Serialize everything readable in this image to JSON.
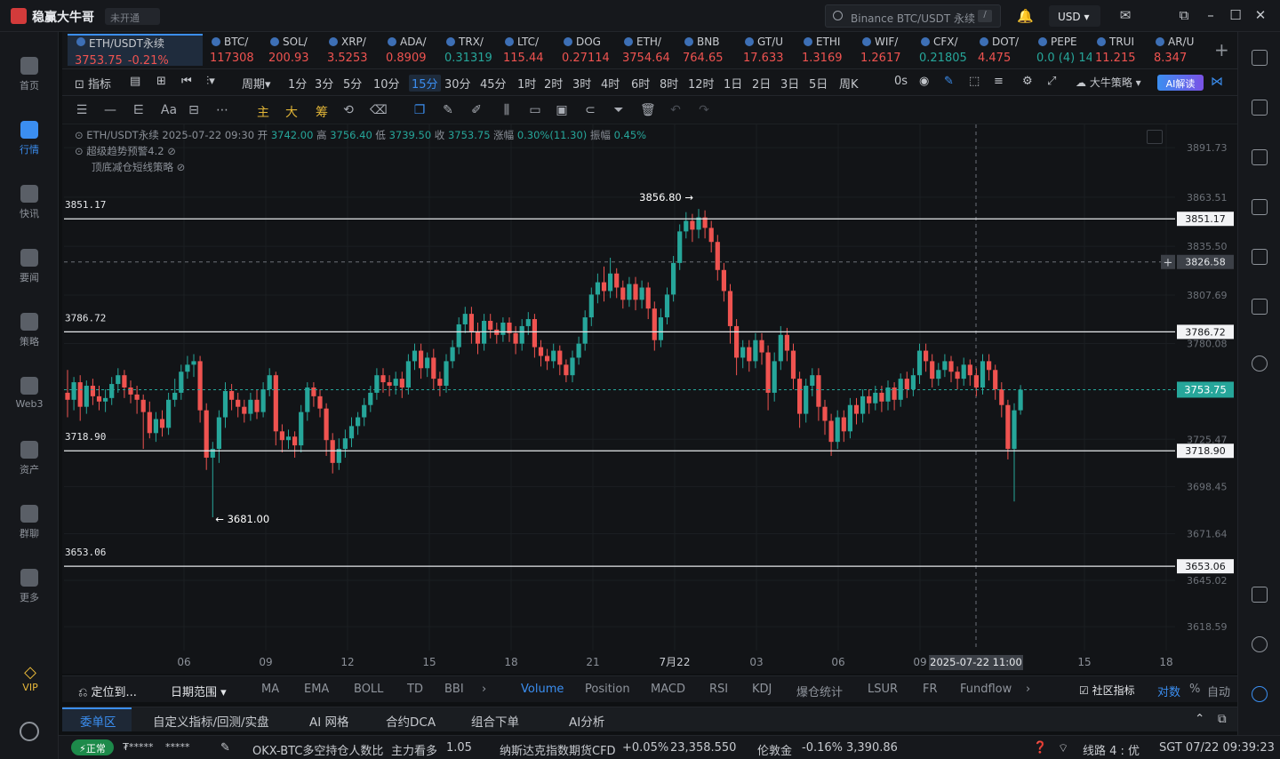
{
  "app": {
    "name": "稳赢大牛哥",
    "account_status": "未开通"
  },
  "search": {
    "placeholder": "Binance BTC/USDT 永续",
    "shortcut": "/"
  },
  "currency": "USD",
  "left_nav": [
    {
      "label": "首页"
    },
    {
      "label": "行情"
    },
    {
      "label": "快讯"
    },
    {
      "label": "要闻"
    },
    {
      "label": "策略"
    },
    {
      "label": "Web3"
    },
    {
      "label": "资产"
    },
    {
      "label": "群聊"
    },
    {
      "label": "更多"
    }
  ],
  "vip_label": "VIP",
  "tickers": [
    {
      "name": "ETH/USDT永续",
      "price": "3753.75",
      "change": "-0.21%",
      "dir": "dn"
    },
    {
      "name": "BTC/",
      "price": "117308",
      "dir": "dn"
    },
    {
      "name": "SOL/",
      "price": "200.93",
      "dir": "dn"
    },
    {
      "name": "XRP/",
      "price": "3.5253",
      "dir": "dn"
    },
    {
      "name": "ADA/",
      "price": "0.8909",
      "dir": "dn"
    },
    {
      "name": "TRX/",
      "price": "0.31319",
      "dir": "up"
    },
    {
      "name": "LTC/",
      "price": "115.44",
      "dir": "dn"
    },
    {
      "name": "DOG",
      "price": "0.27114",
      "dir": "dn"
    },
    {
      "name": "ETH/",
      "price": "3754.64",
      "dir": "dn"
    },
    {
      "name": "BNB",
      "price": "764.65",
      "dir": "dn"
    },
    {
      "name": "GT/U",
      "price": "17.633",
      "dir": "dn"
    },
    {
      "name": "ETHI",
      "price": "1.3169",
      "dir": "dn"
    },
    {
      "name": "WIF/",
      "price": "1.2617",
      "dir": "dn"
    },
    {
      "name": "CFX/",
      "price": "0.21805",
      "dir": "up"
    },
    {
      "name": "DOT/",
      "price": "4.475",
      "dir": "dn"
    },
    {
      "name": "PEPE",
      "price": "0.0 (4) 14",
      "dir": "up"
    },
    {
      "name": "TRUI",
      "price": "11.215",
      "dir": "dn"
    },
    {
      "name": "AR/U",
      "price": "8.347",
      "dir": "dn"
    }
  ],
  "toolbar": {
    "indicator_label": "指标",
    "period_label": "周期",
    "timeframes": [
      "1分",
      "3分",
      "5分",
      "10分",
      "15分",
      "30分",
      "45分",
      "1时",
      "2时",
      "3时",
      "4时",
      "6时",
      "8时",
      "12时",
      "1日",
      "2日",
      "3日",
      "5日",
      "周K"
    ],
    "active_timeframe": "15分",
    "countdown": "0s",
    "strategy_label": "大牛策略",
    "ai_label": "AI解读",
    "main_label": "主",
    "big_label": "大",
    "chip_label": "筹"
  },
  "legend": {
    "symbol": "ETH/USDT永续",
    "time": "2025-07-22 09:30",
    "open_label": "开",
    "open": "3742.00",
    "high_label": "高",
    "high": "3756.40",
    "low_label": "低",
    "low": "3739.50",
    "close_label": "收",
    "close": "3753.75",
    "change_label": "涨幅",
    "change": "0.30%(11.30)",
    "amp_label": "振幅",
    "amp": "0.45%",
    "indicator1": "超级趋势预警4.2",
    "indicator2": "顶底减仓短线策略"
  },
  "chart_data": {
    "type": "candlestick",
    "symbol": "ETH/USDT永续",
    "interval": "15分",
    "price_axis_ticks": [
      3891.73,
      3863.51,
      3835.5,
      3807.69,
      3780.08,
      3725.47,
      3698.45,
      3671.64,
      3645.02,
      3618.59
    ],
    "time_axis_ticks": [
      "06",
      "09",
      "12",
      "15",
      "18",
      "21",
      "7月22",
      "03",
      "06",
      "09",
      "15",
      "18"
    ],
    "crosshair_time": "2025-07-22 11:00",
    "crosshair_price": "3826.58",
    "last_price": "3753.75",
    "horizontal_lines": [
      3851.17,
      3786.72,
      3718.9,
      3653.06
    ],
    "horizontal_line_labels": [
      "3851.17",
      "3786.72",
      "3718.90",
      "3653.06"
    ],
    "annotations": [
      {
        "text": "3856.80 →",
        "price": 3856.8
      },
      {
        "text": "← 3681.00",
        "price": 3681.0
      }
    ],
    "ylim": [
      3605,
      3905
    ],
    "candles": [
      [
        3752,
        3748,
        3738,
        3765
      ],
      [
        3748,
        3758,
        3742,
        3761
      ],
      [
        3758,
        3744,
        3736,
        3762
      ],
      [
        3744,
        3756,
        3740,
        3759
      ],
      [
        3756,
        3750,
        3745,
        3760
      ],
      [
        3750,
        3747,
        3742,
        3756
      ],
      [
        3747,
        3749,
        3741,
        3754
      ],
      [
        3749,
        3757,
        3745,
        3761
      ],
      [
        3757,
        3762,
        3752,
        3766
      ],
      [
        3762,
        3755,
        3749,
        3765
      ],
      [
        3755,
        3751,
        3746,
        3759
      ],
      [
        3751,
        3748,
        3740,
        3756
      ],
      [
        3748,
        3741,
        3720,
        3751
      ],
      [
        3741,
        3729,
        3726,
        3747
      ],
      [
        3729,
        3737,
        3724,
        3741
      ],
      [
        3737,
        3732,
        3727,
        3742
      ],
      [
        3732,
        3748,
        3728,
        3752
      ],
      [
        3748,
        3752,
        3744,
        3760
      ],
      [
        3752,
        3764,
        3748,
        3768
      ],
      [
        3764,
        3768,
        3760,
        3773
      ],
      [
        3768,
        3770,
        3761,
        3774
      ],
      [
        3770,
        3742,
        3735,
        3773
      ],
      [
        3742,
        3715,
        3708,
        3746
      ],
      [
        3715,
        3720,
        3681,
        3724
      ],
      [
        3720,
        3738,
        3712,
        3742
      ],
      [
        3738,
        3753,
        3732,
        3758
      ],
      [
        3753,
        3748,
        3742,
        3757
      ],
      [
        3748,
        3744,
        3738,
        3752
      ],
      [
        3744,
        3740,
        3735,
        3748
      ],
      [
        3740,
        3748,
        3736,
        3752
      ],
      [
        3748,
        3741,
        3737,
        3754
      ],
      [
        3741,
        3754,
        3738,
        3758
      ],
      [
        3754,
        3762,
        3750,
        3766
      ],
      [
        3762,
        3730,
        3722,
        3764
      ],
      [
        3730,
        3725,
        3718,
        3734
      ],
      [
        3725,
        3727,
        3720,
        3731
      ],
      [
        3727,
        3722,
        3715,
        3730
      ],
      [
        3722,
        3741,
        3718,
        3745
      ],
      [
        3741,
        3755,
        3736,
        3758
      ],
      [
        3755,
        3750,
        3744,
        3758
      ],
      [
        3750,
        3743,
        3738,
        3754
      ],
      [
        3743,
        3725,
        3716,
        3746
      ],
      [
        3725,
        3712,
        3706,
        3729
      ],
      [
        3712,
        3720,
        3708,
        3726
      ],
      [
        3720,
        3726,
        3715,
        3731
      ],
      [
        3726,
        3733,
        3721,
        3738
      ],
      [
        3733,
        3738,
        3728,
        3741
      ],
      [
        3738,
        3745,
        3733,
        3749
      ],
      [
        3745,
        3752,
        3741,
        3756
      ],
      [
        3752,
        3762,
        3748,
        3766
      ],
      [
        3762,
        3758,
        3752,
        3766
      ],
      [
        3758,
        3756,
        3750,
        3762
      ],
      [
        3756,
        3760,
        3751,
        3764
      ],
      [
        3760,
        3755,
        3749,
        3764
      ],
      [
        3755,
        3770,
        3751,
        3774
      ],
      [
        3770,
        3776,
        3765,
        3780
      ],
      [
        3776,
        3766,
        3760,
        3780
      ],
      [
        3766,
        3772,
        3761,
        3775
      ],
      [
        3772,
        3760,
        3754,
        3777
      ],
      [
        3760,
        3756,
        3750,
        3764
      ],
      [
        3756,
        3770,
        3752,
        3774
      ],
      [
        3770,
        3778,
        3766,
        3782
      ],
      [
        3778,
        3791,
        3774,
        3795
      ],
      [
        3791,
        3797,
        3786,
        3801
      ],
      [
        3797,
        3787,
        3780,
        3801
      ],
      [
        3787,
        3780,
        3774,
        3792
      ],
      [
        3780,
        3793,
        3776,
        3797
      ],
      [
        3793,
        3788,
        3783,
        3797
      ],
      [
        3788,
        3785,
        3780,
        3792
      ],
      [
        3785,
        3792,
        3781,
        3795
      ],
      [
        3792,
        3786,
        3781,
        3795
      ],
      [
        3786,
        3780,
        3774,
        3790
      ],
      [
        3780,
        3790,
        3776,
        3794
      ],
      [
        3790,
        3794,
        3785,
        3798
      ],
      [
        3794,
        3778,
        3772,
        3797
      ],
      [
        3778,
        3773,
        3767,
        3782
      ],
      [
        3773,
        3770,
        3765,
        3777
      ],
      [
        3770,
        3776,
        3766,
        3780
      ],
      [
        3776,
        3768,
        3762,
        3779
      ],
      [
        3768,
        3762,
        3758,
        3771
      ],
      [
        3762,
        3772,
        3758,
        3776
      ],
      [
        3772,
        3780,
        3768,
        3784
      ],
      [
        3780,
        3795,
        3776,
        3799
      ],
      [
        3795,
        3808,
        3790,
        3812
      ],
      [
        3808,
        3815,
        3803,
        3820
      ],
      [
        3815,
        3810,
        3804,
        3824
      ],
      [
        3810,
        3820,
        3806,
        3829
      ],
      [
        3820,
        3812,
        3806,
        3823
      ],
      [
        3812,
        3805,
        3800,
        3816
      ],
      [
        3805,
        3814,
        3801,
        3818
      ],
      [
        3814,
        3805,
        3799,
        3818
      ],
      [
        3805,
        3812,
        3800,
        3816
      ],
      [
        3812,
        3800,
        3794,
        3815
      ],
      [
        3800,
        3782,
        3776,
        3804
      ],
      [
        3782,
        3795,
        3778,
        3800
      ],
      [
        3795,
        3808,
        3791,
        3812
      ],
      [
        3808,
        3826,
        3804,
        3830
      ],
      [
        3826,
        3844,
        3822,
        3848
      ],
      [
        3844,
        3850,
        3840,
        3855
      ],
      [
        3850,
        3845,
        3838,
        3854
      ],
      [
        3845,
        3852,
        3840,
        3856.8
      ],
      [
        3852,
        3846,
        3840,
        3856
      ],
      [
        3846,
        3838,
        3832,
        3850
      ],
      [
        3838,
        3822,
        3816,
        3842
      ],
      [
        3822,
        3810,
        3804,
        3826
      ],
      [
        3810,
        3790,
        3780,
        3814
      ],
      [
        3790,
        3772,
        3762,
        3794
      ],
      [
        3772,
        3778,
        3766,
        3782
      ],
      [
        3778,
        3770,
        3764,
        3782
      ],
      [
        3770,
        3782,
        3766,
        3786
      ],
      [
        3782,
        3775,
        3768,
        3786
      ],
      [
        3775,
        3752,
        3742,
        3779
      ],
      [
        3752,
        3770,
        3747,
        3775
      ],
      [
        3770,
        3785,
        3765,
        3790
      ],
      [
        3785,
        3776,
        3770,
        3789
      ],
      [
        3776,
        3760,
        3754,
        3780
      ],
      [
        3760,
        3740,
        3732,
        3764
      ],
      [
        3740,
        3756,
        3735,
        3760
      ],
      [
        3756,
        3762,
        3750,
        3766
      ],
      [
        3762,
        3744,
        3736,
        3766
      ],
      [
        3744,
        3736,
        3728,
        3748
      ],
      [
        3736,
        3724,
        3716,
        3740
      ],
      [
        3724,
        3738,
        3720,
        3742
      ],
      [
        3738,
        3730,
        3724,
        3742
      ],
      [
        3730,
        3745,
        3726,
        3749
      ],
      [
        3745,
        3740,
        3734,
        3749
      ],
      [
        3740,
        3750,
        3735,
        3754
      ],
      [
        3750,
        3746,
        3740,
        3754
      ],
      [
        3746,
        3752,
        3742,
        3756
      ],
      [
        3752,
        3747,
        3741,
        3756
      ],
      [
        3747,
        3755,
        3742,
        3759
      ],
      [
        3755,
        3748,
        3742,
        3758
      ],
      [
        3748,
        3760,
        3744,
        3763
      ],
      [
        3760,
        3754,
        3749,
        3764
      ],
      [
        3754,
        3762,
        3750,
        3766
      ],
      [
        3762,
        3776,
        3757,
        3780
      ],
      [
        3776,
        3770,
        3764,
        3780
      ],
      [
        3770,
        3760,
        3755,
        3774
      ],
      [
        3760,
        3765,
        3756,
        3769
      ],
      [
        3765,
        3770,
        3761,
        3774
      ],
      [
        3770,
        3764,
        3758,
        3773
      ],
      [
        3764,
        3760,
        3754,
        3767
      ],
      [
        3760,
        3768,
        3756,
        3772
      ],
      [
        3768,
        3762,
        3756,
        3771
      ],
      [
        3762,
        3755,
        3750,
        3766
      ],
      [
        3755,
        3770,
        3751,
        3774
      ],
      [
        3770,
        3765,
        3759,
        3774
      ],
      [
        3765,
        3754,
        3748,
        3768
      ],
      [
        3754,
        3745,
        3738,
        3758
      ],
      [
        3745,
        3720,
        3714,
        3748
      ],
      [
        3720,
        3742,
        3690,
        3746
      ],
      [
        3742,
        3753.75,
        3739.5,
        3756.4
      ]
    ]
  },
  "indicator_bar": {
    "locate_label": "定位到...",
    "date_range_label": "日期范围",
    "items": [
      "MA",
      "EMA",
      "BOLL",
      "TD",
      "BBI"
    ],
    "sub_items": [
      "Volume",
      "Position",
      "MACD",
      "RSI",
      "KDJ",
      "爆仓统计",
      "LSUR",
      "FR",
      "Fundflow"
    ],
    "active_sub": "Volume",
    "community_label": "社区指标",
    "log_label": "对数",
    "percent_label": "%",
    "auto_label": "自动"
  },
  "order_tabs": [
    "委单区",
    "自定义指标/回测/实盘",
    "AI 网格",
    "合约DCA",
    "组合下单",
    "AI分析"
  ],
  "status_bar": {
    "status": "正常",
    "masked1": "₮*****",
    "masked2": "*****",
    "ticker1_name": "OKX-BTC多空持仓人数比",
    "ticker1_tag": "主力看多",
    "ticker1_value": "1.05",
    "ticker2_name": "纳斯达克指数期货CFD",
    "ticker2_change": "+0.05%",
    "ticker2_value": "23,358.550",
    "ticker3_name": "伦敦金",
    "ticker3_change": "-0.16%",
    "ticker3_value": "3,390.86",
    "line_label": "线路 4 : 优",
    "clock": "SGT 07/22 09:39:23"
  },
  "colors": {
    "up": "#26a69a",
    "down": "#ef5350",
    "accent": "#3b8ef0",
    "background": "#121417"
  }
}
